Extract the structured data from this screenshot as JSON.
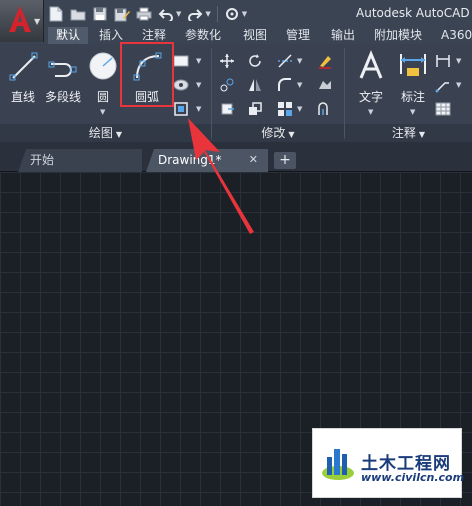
{
  "titlebar": {
    "product_title": "Autodesk AutoCAD"
  },
  "quick_access": {
    "icons": [
      "new-file-icon",
      "open-folder-icon",
      "save-icon",
      "save-as-icon",
      "print-icon",
      "undo-icon",
      "redo-icon",
      "workspace-icon"
    ]
  },
  "ribbon_tabs": [
    {
      "label": "默认",
      "active": true
    },
    {
      "label": "插入"
    },
    {
      "label": "注释"
    },
    {
      "label": "参数化"
    },
    {
      "label": "视图"
    },
    {
      "label": "管理"
    },
    {
      "label": "输出"
    },
    {
      "label": "附加模块"
    },
    {
      "label": "A360"
    }
  ],
  "draw_panel": {
    "title": "绘图",
    "tools": [
      {
        "label": "直线",
        "icon": "line-icon"
      },
      {
        "label": "多段线",
        "icon": "polyline-icon"
      },
      {
        "label": "圆",
        "icon": "circle-icon"
      },
      {
        "label": "圆弧",
        "icon": "arc-icon"
      }
    ]
  },
  "modify_panel": {
    "title": "修改"
  },
  "annotation_panel": {
    "title": "注释",
    "tools": [
      {
        "label": "文字",
        "icon": "text-icon"
      },
      {
        "label": "标注",
        "icon": "dimension-icon"
      }
    ]
  },
  "file_tabs": [
    {
      "label": "开始"
    },
    {
      "label": "Drawing1*",
      "active": true
    }
  ],
  "colors": {
    "highlight_border": "#e8353b",
    "annotation_arrow": "#e8353b",
    "canvas_background": "#1b1f26",
    "ribbon_background": "#3a4150"
  },
  "watermark": {
    "name": "土木工程网",
    "url": "www.civilcn.com"
  }
}
